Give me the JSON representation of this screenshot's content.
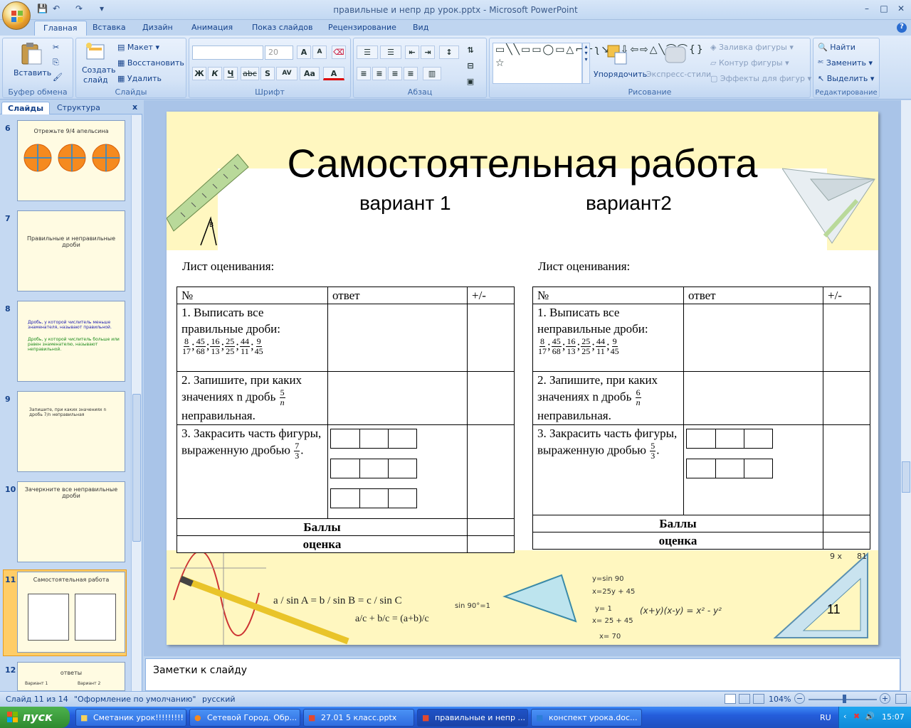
{
  "window": {
    "title": "правильные и непр др урок.pptx - Microsoft PowerPoint",
    "qat_icons": [
      "save-icon",
      "undo-icon",
      "redo-icon",
      "customize-icon"
    ],
    "controls": [
      "–",
      "□",
      "✕"
    ]
  },
  "tabs": [
    "Главная",
    "Вставка",
    "Дизайн",
    "Анимация",
    "Показ слайдов",
    "Рецензирование",
    "Вид"
  ],
  "active_tab": "Главная",
  "ribbon": {
    "clipboard": {
      "paste": "Вставить",
      "label": "Буфер обмена"
    },
    "slides": {
      "create": "Создать",
      "create2": "слайд",
      "layout": "Макет",
      "reset": "Восстановить",
      "delete": "Удалить",
      "label": "Слайды"
    },
    "font": {
      "size": "20",
      "label": "Шрифт",
      "b": "Ж",
      "i": "К",
      "u": "Ч",
      "s": "abc",
      "sh": "S",
      "sp": "AV",
      "aa": "Aa"
    },
    "paragraph": {
      "label": "Абзац"
    },
    "drawing": {
      "arrange": "Упорядочить",
      "styles": "Экспресс-стили",
      "fill": "Заливка фигуры",
      "outline": "Контур фигуры",
      "effects": "Эффекты для фигур",
      "label": "Рисование"
    },
    "editing": {
      "find": "Найти",
      "replace": "Заменить",
      "select": "Выделить",
      "label": "Редактирование"
    }
  },
  "left_panel": {
    "tabs": [
      "Слайды",
      "Структура"
    ],
    "close": "x",
    "thumbs": [
      {
        "num": "6",
        "title": "Отрежьте 9/4 апельсина"
      },
      {
        "num": "7",
        "title": "Правильные и неправильные дроби"
      },
      {
        "num": "8",
        "title": "Дробь, у которой числитель меньше знаменателя, называют правильной.",
        "title2": "Дробь, у которой числитель больше или равен знаменателю, называют неправильной."
      },
      {
        "num": "9",
        "title": "Запишите, при каких значениях n дробь 7/n неправильная"
      },
      {
        "num": "10",
        "title": "Зачеркните все неправильные дроби"
      },
      {
        "num": "11",
        "title": "Самостоятельная работа"
      },
      {
        "num": "12",
        "title": "ответы",
        "v1": "Вариант 1",
        "v2": "Вариант 2"
      }
    ]
  },
  "slide": {
    "title": "Самостоятельная работа",
    "variant1": "вариант  1",
    "variant2": "вариант2",
    "slide_number": "11",
    "sheet_label": "Лист оценивания:",
    "headers": [
      "№",
      "ответ",
      "+/-"
    ],
    "v1": {
      "task1": "1. Выписать все правильные дроби:",
      "task2a": "2. Запишите, при каких значениях n дробь",
      "task2_num": "5",
      "task2b": "неправильная.",
      "task3": "3. Закрасить часть фигуры, выраженную дробью",
      "task3_num": "7",
      "task3_den": "3"
    },
    "v2": {
      "task1": "1. Выписать все неправильные дроби:",
      "task2a": "2. Запишите, при каких значениях n дробь",
      "task2_num": "6",
      "task2b": "неправильная.",
      "task3": "3. Закрасить часть фигуры, выраженную дробью",
      "task3_num": "5",
      "task3_den": "3"
    },
    "fractions": [
      [
        "8",
        "17"
      ],
      [
        "45",
        "68"
      ],
      [
        "16",
        "13"
      ],
      [
        "25",
        "25"
      ],
      [
        "44",
        "11"
      ],
      [
        "9",
        "45"
      ]
    ],
    "n_letter": "n",
    "points": "Баллы",
    "grade": "оценка",
    "decor": {
      "formula1": "sin 90°=1",
      "f2": "y=sin 90",
      "f3": "x=25y + 45",
      "f4": "y= 1",
      "f5": "x= 25 + 45",
      "f6": "x= 70",
      "f7": "(x+y)(x-y) =  x² - y²",
      "corner": "9 x",
      "corner2": "81"
    }
  },
  "notes_placeholder": "Заметки к слайду",
  "status": {
    "slide": "Слайд 11 из 14",
    "theme": "\"Оформление по умолчанию\"",
    "lang": "русский",
    "zoom": "104%"
  },
  "taskbar": {
    "start": "пуск",
    "items": [
      "Сметаник урок!!!!!!!!!",
      "Сетевой Город. Обр...",
      "27.01 5 класс.pptx",
      "правильные и непр ...",
      "конспект урока.doc..."
    ],
    "lang": "RU",
    "time": "15:07"
  },
  "colors": {
    "ribbon": "#dbe7f8",
    "accent": "#15428b",
    "slide_band": "#fff7c0",
    "selected_thumb": "#ffcd67"
  }
}
